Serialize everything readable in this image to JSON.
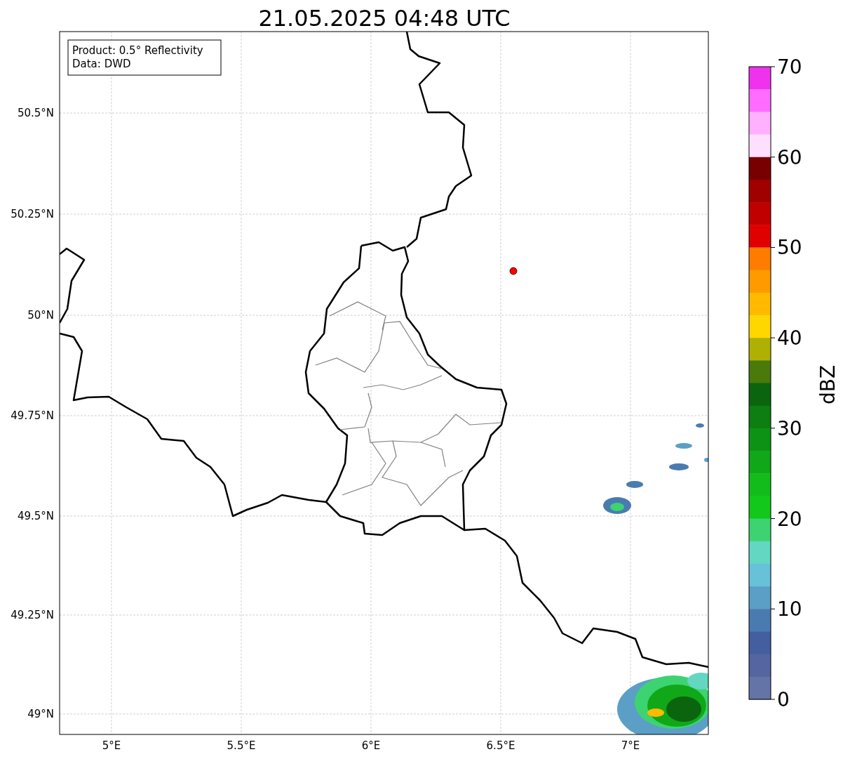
{
  "title": "21.05.2025 04:48 UTC",
  "info_box": [
    "Product: 0.5° Reflectivity",
    "Data: DWD"
  ],
  "lat_ticks": [
    "50.5°N",
    "50.25°N",
    "50°N",
    "49.75°N",
    "49.5°N",
    "49.25°N",
    "49°N"
  ],
  "lon_ticks": [
    "5°E",
    "5.5°E",
    "6°E",
    "6.5°E",
    "7°E"
  ],
  "colorbar": {
    "label": "dBZ",
    "ticks": [
      "70",
      "60",
      "50",
      "40",
      "30",
      "20",
      "10",
      "0"
    ],
    "bands": [
      {
        "color": "#ee32ee"
      },
      {
        "color": "#ff6cff"
      },
      {
        "color": "#ffb0ff"
      },
      {
        "color": "#ffdfff"
      },
      {
        "color": "#780000"
      },
      {
        "color": "#a00000"
      },
      {
        "color": "#c00000"
      },
      {
        "color": "#e00000"
      },
      {
        "color": "#ff7c00"
      },
      {
        "color": "#ff9a00"
      },
      {
        "color": "#ffba00"
      },
      {
        "color": "#ffd700"
      },
      {
        "color": "#b0b004"
      },
      {
        "color": "#4a7a0a"
      },
      {
        "color": "#0a650e"
      },
      {
        "color": "#0c7e12"
      },
      {
        "color": "#0e9215"
      },
      {
        "color": "#10a818"
      },
      {
        "color": "#12bc1a"
      },
      {
        "color": "#12c81a"
      },
      {
        "color": "#3dd370"
      },
      {
        "color": "#63d7c2"
      },
      {
        "color": "#67c2d9"
      },
      {
        "color": "#5b9fc6"
      },
      {
        "color": "#4a7bb0"
      },
      {
        "color": "#435fa0"
      },
      {
        "color": "#5465a0"
      },
      {
        "color": "#6474a6"
      }
    ]
  }
}
